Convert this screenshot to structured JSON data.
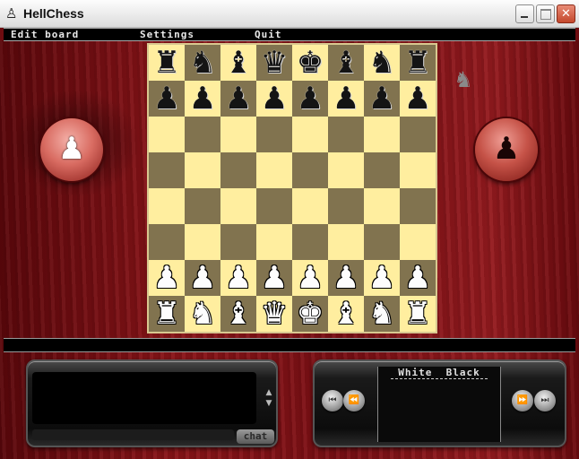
{
  "window": {
    "title": "HellChess",
    "app_icon": "chess-pawn-icon",
    "controls": {
      "minimize": "minimize-icon",
      "maximize": "maximize-icon",
      "close": "close-icon"
    }
  },
  "menu": {
    "items": [
      "Edit board",
      "Settings",
      "Quit"
    ]
  },
  "board": {
    "light_color": "#ffee9f",
    "dark_color": "#81734f",
    "ranks": [
      [
        "r",
        "n",
        "b",
        "q",
        "k",
        "b",
        "n",
        "r"
      ],
      [
        "p",
        "p",
        "p",
        "p",
        "p",
        "p",
        "p",
        "p"
      ],
      [
        "",
        "",
        "",
        "",
        "",
        "",
        "",
        ""
      ],
      [
        "",
        "",
        "",
        "",
        "",
        "",
        "",
        ""
      ],
      [
        "",
        "",
        "",
        "",
        "",
        "",
        "",
        ""
      ],
      [
        "",
        "",
        "",
        "",
        "",
        "",
        "",
        ""
      ],
      [
        "P",
        "P",
        "P",
        "P",
        "P",
        "P",
        "P",
        "P"
      ],
      [
        "R",
        "N",
        "B",
        "Q",
        "K",
        "B",
        "N",
        "R"
      ]
    ]
  },
  "players": {
    "white_orb_icon": "white-pawn-icon",
    "black_orb_icon": "black-pawn-icon",
    "mascot_icon": "mascot-icon"
  },
  "chat": {
    "button_label": "chat",
    "scroll_up_icon": "chevron-up-icon",
    "scroll_down_icon": "chevron-down-icon"
  },
  "moves": {
    "header": "White  Black",
    "nav": {
      "first": "first-move-icon",
      "prev": "previous-move-icon",
      "next": "next-move-icon",
      "last": "last-move-icon"
    }
  },
  "colors": {
    "wood_red": "#7a0f14",
    "panel_black": "#0c0c0c"
  }
}
